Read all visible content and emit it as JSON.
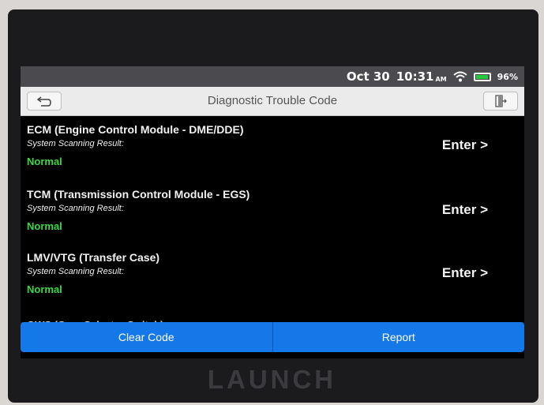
{
  "status_bar": {
    "date": "Oct 30",
    "time": "10:31",
    "ampm": "AM",
    "battery": "96%",
    "battery_level": 0.96
  },
  "header": {
    "title": "Diagnostic Trouble Code",
    "back_icon": "back-icon",
    "exit_icon": "exit-icon"
  },
  "items": [
    {
      "title": "ECM (Engine Control Module - DME/DDE)",
      "subtitle": "System Scanning Result:",
      "status": "Normal",
      "action": "Enter >"
    },
    {
      "title": "TCM (Transmission Control Module - EGS)",
      "subtitle": "System Scanning Result:",
      "status": "Normal",
      "action": "Enter >"
    },
    {
      "title": "LMV/VTG (Transfer Case)",
      "subtitle": "System Scanning Result:",
      "status": "Normal",
      "action": "Enter >"
    }
  ],
  "partial_item": {
    "title": "GWS (Gear Selector Switch)"
  },
  "actions": {
    "clear": "Clear Code",
    "report": "Report"
  },
  "brand": "LAUNCH",
  "colors": {
    "accent": "#1478e8",
    "status_normal": "#3dd84a",
    "background": "#000000"
  }
}
